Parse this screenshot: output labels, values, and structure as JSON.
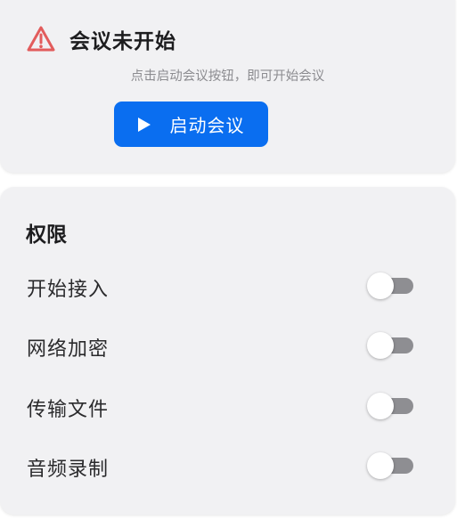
{
  "status": {
    "title": "会议未开始",
    "hint": "点击启动会议按钮，即可开始会议",
    "start_button_label": "启动会议",
    "warning_color": "#e25c5c",
    "accent_color": "#0a6ef0"
  },
  "permissions": {
    "title": "权限",
    "items": [
      {
        "label": "开始接入",
        "enabled": false
      },
      {
        "label": "网络加密",
        "enabled": false
      },
      {
        "label": "传输文件",
        "enabled": false
      },
      {
        "label": "音频录制",
        "enabled": false
      }
    ]
  }
}
